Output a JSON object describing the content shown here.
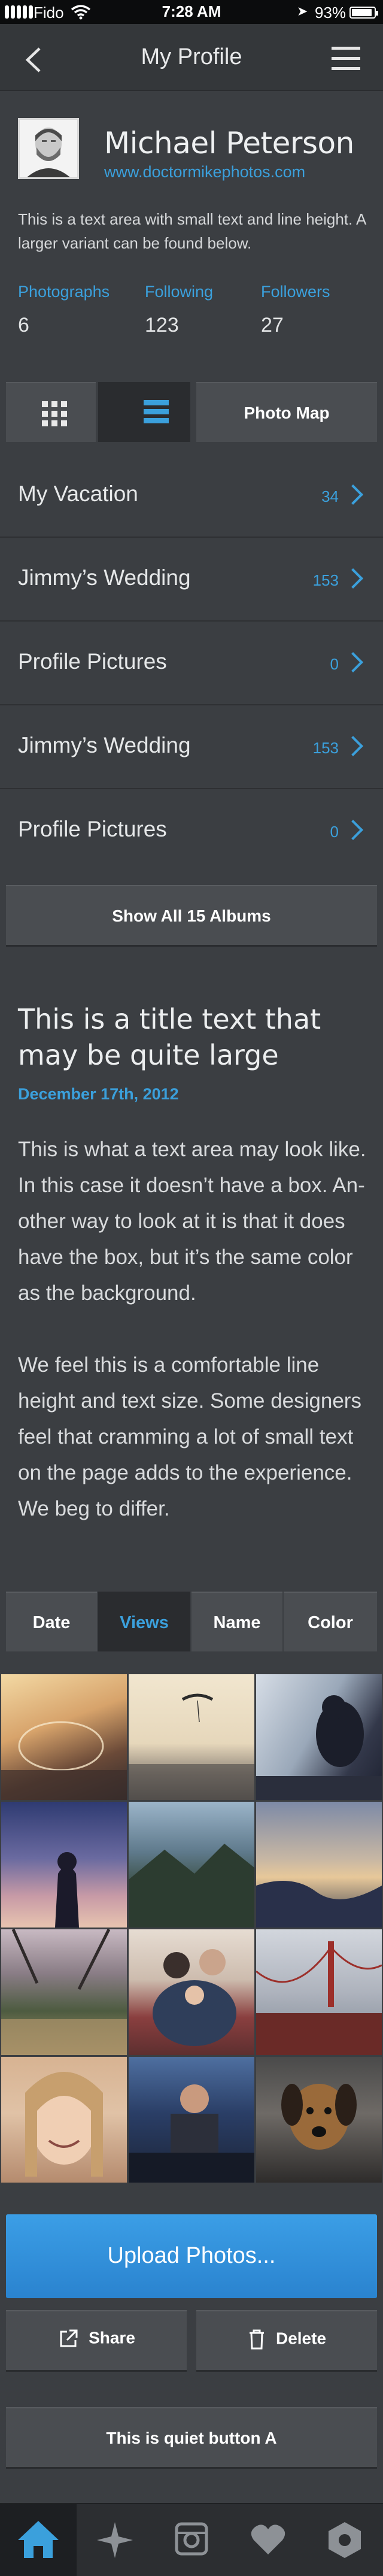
{
  "status_bar": {
    "carrier": "Fido",
    "time": "7:28 AM",
    "battery": "93%",
    "battery_level": 0.93
  },
  "nav": {
    "title": "My Profile",
    "back_icon": "chevron-left-icon",
    "menu_icon": "hamburger-menu-icon"
  },
  "profile": {
    "name": "Michael Peterson",
    "link": "www.doctormikephotos.com",
    "description": "This is a text area with small text and line height. A larger variant can be found below.",
    "stats": [
      {
        "label": "Photographs",
        "value": "6"
      },
      {
        "label": "Following",
        "value": "123"
      },
      {
        "label": "Followers",
        "value": "27"
      }
    ]
  },
  "view_switch": {
    "grid_icon": "grid-view-icon",
    "list_icon": "list-view-icon",
    "photo_map_label": "Photo Map",
    "selected": "list"
  },
  "albums": [
    {
      "title": "My Vacation",
      "count": "34"
    },
    {
      "title": "Jimmy’s Wedding",
      "count": "153"
    },
    {
      "title": "Profile Pictures",
      "count": "0"
    },
    {
      "title": "Jimmy’s Wedding",
      "count": "153"
    },
    {
      "title": "Profile Pictures",
      "count": "0"
    }
  ],
  "show_all_label": "Show All 15 Albums",
  "article": {
    "title": "This is a title text that may be quite large",
    "date": "December 17th, 2012",
    "paragraphs": [
      "This is what a text area may look like. In this case it doesn’t have a box. An-other way to look at it is that it does have the box, but it’s the same color as the background.",
      "We feel this is a comfortable line height and text size. Some designers feel that cramming a lot of small text on the page adds to the experience. We beg to differ."
    ]
  },
  "sort_tabs": [
    {
      "label": "Date"
    },
    {
      "label": "Views"
    },
    {
      "label": "Name"
    },
    {
      "label": "Color"
    }
  ],
  "sort_selected": "Views",
  "photos": [
    "beach-bubble-photo",
    "paraglider-photo",
    "man-at-window-photo",
    "silhouette-photo",
    "mountain-valley-photo",
    "coastline-photo",
    "city-trees-photo",
    "couple-with-baby-photo",
    "golden-gate-bridge-photo",
    "smiling-woman-photo",
    "man-at-table-photo",
    "dog-photo"
  ],
  "buttons": {
    "upload": "Upload Photos...",
    "share": "Share",
    "delete": "Delete",
    "quiet": "This is quiet button A"
  },
  "tab_bar": [
    {
      "icon": "home-icon",
      "active": true
    },
    {
      "icon": "compass-star-icon",
      "active": false
    },
    {
      "icon": "camera-icon",
      "active": false
    },
    {
      "icon": "heart-icon",
      "active": false
    },
    {
      "icon": "hexagon-icon",
      "active": false
    }
  ],
  "colors": {
    "background": "#3b3e42",
    "accent": "#3ba0dc",
    "button": "#4a4d51",
    "button_dark": "#2a2c2f",
    "upload": "#2f8dd9"
  }
}
